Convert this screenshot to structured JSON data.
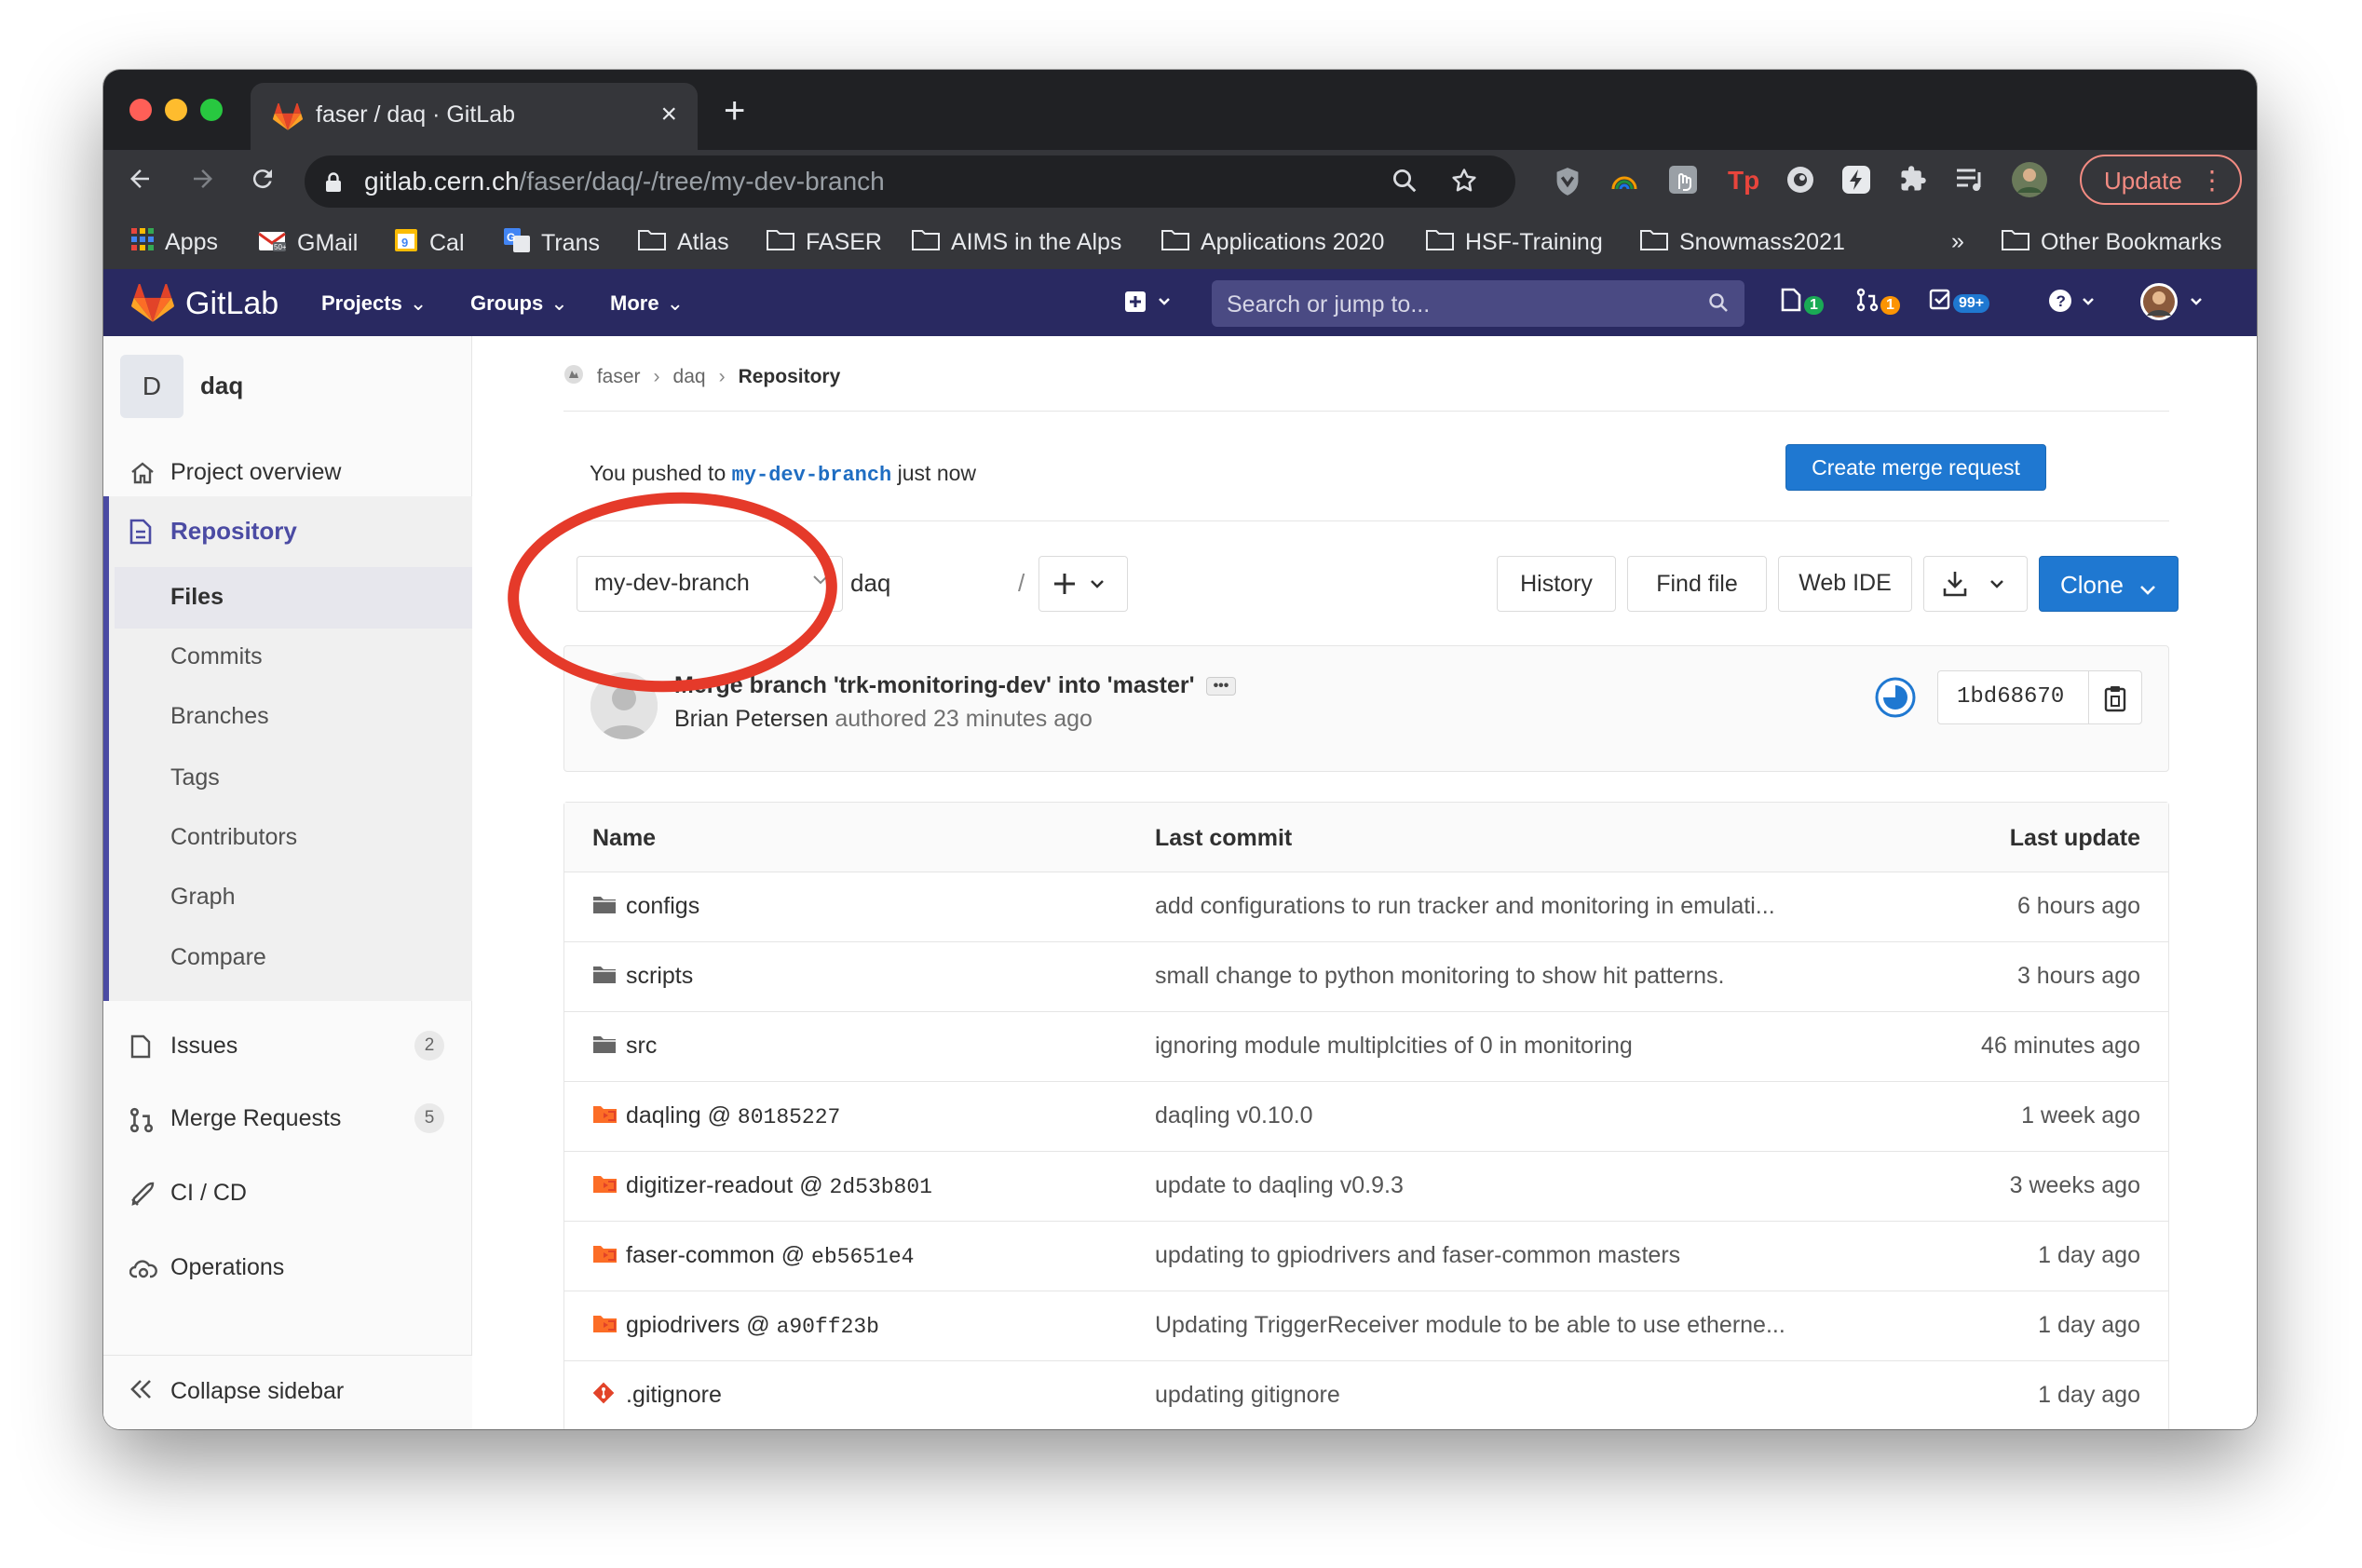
{
  "browser": {
    "tab_title": "faser / daq · GitLab",
    "url_host": "gitlab.cern.ch",
    "url_path": "/faser/daq/-/tree/my-dev-branch",
    "update_label": "Update",
    "bookmarks": [
      "Apps",
      "GMail",
      "Cal",
      "Trans",
      "Atlas",
      "FASER",
      "AIMS in the Alps",
      "Applications 2020",
      "HSF-Training",
      "Snowmass2021"
    ],
    "more_bookmarks": "»",
    "other_bookmarks": "Other Bookmarks"
  },
  "gitlab": {
    "logo_text": "GitLab",
    "nav": [
      "Projects",
      "Groups",
      "More"
    ],
    "search_placeholder": "Search or jump to...",
    "issues_badge": "1",
    "mr_badge": "1",
    "todo_badge": "99+"
  },
  "sidebar": {
    "project_initial": "D",
    "project_name": "daq",
    "project_overview": "Project overview",
    "repository": "Repository",
    "repo_items": [
      "Files",
      "Commits",
      "Branches",
      "Tags",
      "Contributors",
      "Graph",
      "Compare"
    ],
    "issues": "Issues",
    "issues_count": "2",
    "merge_requests": "Merge Requests",
    "mr_count": "5",
    "cicd": "CI / CD",
    "operations": "Operations",
    "collapse": "Collapse sidebar"
  },
  "breadcrumb": [
    "faser",
    "daq",
    "Repository"
  ],
  "push_notice": {
    "prefix": "You pushed to",
    "branch": "my-dev-branch",
    "suffix": "just now",
    "button": "Create merge request"
  },
  "toolbar": {
    "branch": "my-dev-branch",
    "path": "daq",
    "path_sep": "/",
    "history": "History",
    "find_file": "Find file",
    "web_ide": "Web IDE",
    "clone": "Clone"
  },
  "last_commit": {
    "title": "Merge branch 'trk-monitoring-dev' into 'master'",
    "author": "Brian Petersen",
    "when": "authored 23 minutes ago",
    "sha": "1bd68670"
  },
  "tree": {
    "headers": [
      "Name",
      "Last commit",
      "Last update"
    ],
    "rows": [
      {
        "name": "configs",
        "ref": "",
        "commit": "add configurations to run tracker and monitoring in emulati...",
        "updated": "6 hours ago",
        "kind": "folder"
      },
      {
        "name": "scripts",
        "ref": "",
        "commit": "small change to python monitoring to show hit patterns.",
        "updated": "3 hours ago",
        "kind": "folder"
      },
      {
        "name": "src",
        "ref": "",
        "commit": "ignoring module multiplcities of 0 in monitoring",
        "updated": "46 minutes ago",
        "kind": "folder"
      },
      {
        "name": "daqling @ ",
        "ref": "80185227",
        "commit": "daqling v0.10.0",
        "updated": "1 week ago",
        "kind": "submodule"
      },
      {
        "name": "digitizer-readout @ ",
        "ref": "2d53b801",
        "commit": "update to daqling v0.9.3",
        "updated": "3 weeks ago",
        "kind": "submodule"
      },
      {
        "name": "faser-common @ ",
        "ref": "eb5651e4",
        "commit": "updating to gpiodrivers and faser-common masters",
        "updated": "1 day ago",
        "kind": "submodule"
      },
      {
        "name": "gpiodrivers @ ",
        "ref": "a90ff23b",
        "commit": "Updating TriggerReceiver module to be able to use etherne...",
        "updated": "1 day ago",
        "kind": "submodule"
      },
      {
        "name": ".gitignore",
        "ref": "",
        "commit": "updating gitignore",
        "updated": "1 day ago",
        "kind": "git"
      }
    ]
  }
}
